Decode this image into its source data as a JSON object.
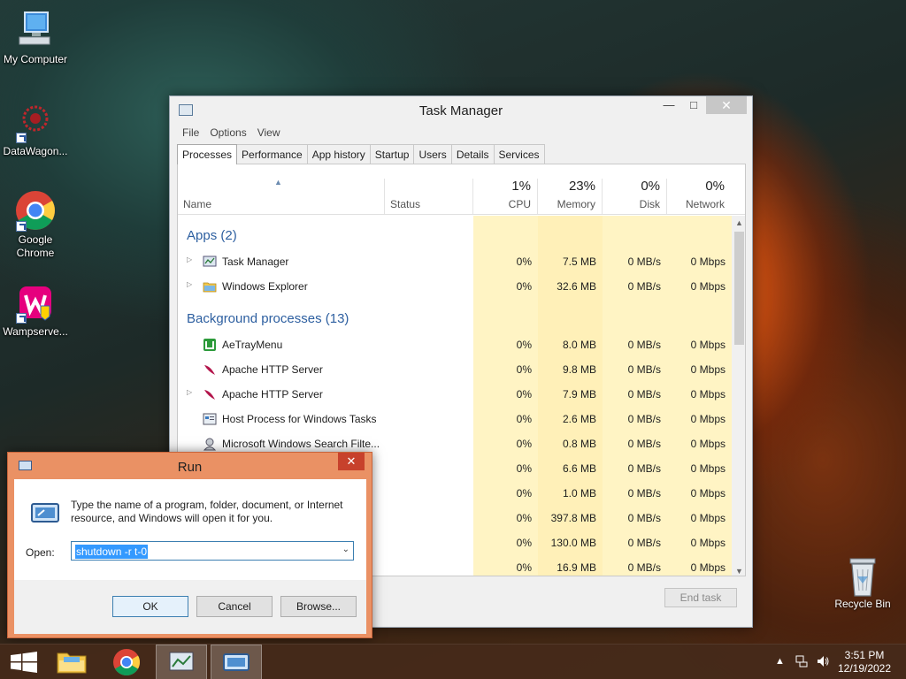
{
  "desktop": {
    "icons": [
      {
        "label": "My Computer"
      },
      {
        "label": "DataWagon..."
      },
      {
        "label": "Google Chrome"
      },
      {
        "label": "Wampserve..."
      }
    ],
    "recycle_bin": "Recycle Bin"
  },
  "task_manager": {
    "title": "Task Manager",
    "menu": [
      "File",
      "Options",
      "View"
    ],
    "tabs": [
      "Processes",
      "Performance",
      "App history",
      "Startup",
      "Users",
      "Details",
      "Services"
    ],
    "active_tab": "Processes",
    "columns": {
      "name": "Name",
      "status": "Status",
      "cpu": {
        "pct": "1%",
        "label": "CPU"
      },
      "memory": {
        "pct": "23%",
        "label": "Memory"
      },
      "disk": {
        "pct": "0%",
        "label": "Disk"
      },
      "network": {
        "pct": "0%",
        "label": "Network"
      }
    },
    "groups": {
      "apps": "Apps (2)",
      "background": "Background processes (13)"
    },
    "apps": [
      {
        "name": "Task Manager",
        "cpu": "0%",
        "memory": "7.5 MB",
        "disk": "0 MB/s",
        "network": "0 Mbps"
      },
      {
        "name": "Windows Explorer",
        "cpu": "0%",
        "memory": "32.6 MB",
        "disk": "0 MB/s",
        "network": "0 Mbps"
      }
    ],
    "background": [
      {
        "name": "AeTrayMenu",
        "cpu": "0%",
        "memory": "8.0 MB",
        "disk": "0 MB/s",
        "network": "0 Mbps"
      },
      {
        "name": "Apache HTTP Server",
        "cpu": "0%",
        "memory": "9.8 MB",
        "disk": "0 MB/s",
        "network": "0 Mbps"
      },
      {
        "name": "Apache HTTP Server",
        "cpu": "0%",
        "memory": "7.9 MB",
        "disk": "0 MB/s",
        "network": "0 Mbps"
      },
      {
        "name": "Host Process for Windows Tasks",
        "cpu": "0%",
        "memory": "2.6 MB",
        "disk": "0 MB/s",
        "network": "0 Mbps"
      },
      {
        "name": "Microsoft Windows Search Filte...",
        "cpu": "0%",
        "memory": "0.8 MB",
        "disk": "0 MB/s",
        "network": "0 Mbps"
      },
      {
        "name": "",
        "cpu": "0%",
        "memory": "6.6 MB",
        "disk": "0 MB/s",
        "network": "0 Mbps"
      },
      {
        "name": "",
        "cpu": "0%",
        "memory": "1.0 MB",
        "disk": "0 MB/s",
        "network": "0 Mbps"
      },
      {
        "name": "",
        "cpu": "0%",
        "memory": "397.8 MB",
        "disk": "0 MB/s",
        "network": "0 Mbps"
      },
      {
        "name": "",
        "cpu": "0%",
        "memory": "130.0 MB",
        "disk": "0 MB/s",
        "network": "0 Mbps"
      },
      {
        "name": "",
        "cpu": "0%",
        "memory": "16.9 MB",
        "disk": "0 MB/s",
        "network": "0 Mbps"
      }
    ],
    "end_task": "End task"
  },
  "run_dialog": {
    "title": "Run",
    "description": "Type the name of a program, folder, document, or Internet resource, and Windows will open it for you.",
    "open_label": "Open:",
    "open_value": "shutdown -r t-0",
    "ok": "OK",
    "cancel": "Cancel",
    "browse": "Browse..."
  },
  "taskbar": {
    "time": "3:51 PM",
    "date": "12/19/2022"
  },
  "colors": {
    "accent_link": "#2d5fa0",
    "cpu_heat": "#fff4c4",
    "memory_heat": "#fff0b8",
    "run_frame": "#ea9164",
    "selection": "#3399ff"
  }
}
